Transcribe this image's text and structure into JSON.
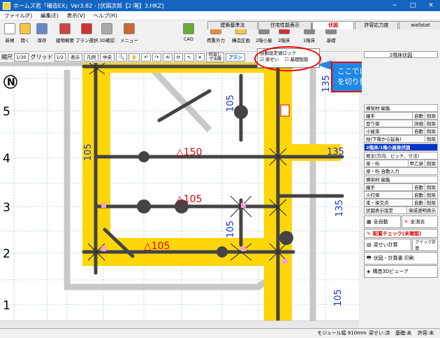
{
  "window": {
    "title": "ホームズ君「構造EX」Ver3.82 - [伏図次郎【2 階】3.HKZ]",
    "min": "−",
    "max": "□",
    "close": "✕"
  },
  "menu": [
    "ファイル(F)",
    "編集(E)",
    "表示(V)",
    "ヘルプ(H)"
  ],
  "toolbar": [
    {
      "label": "新規",
      "icon": "new-file-icon",
      "color": "#ffffff"
    },
    {
      "label": "開く",
      "icon": "open-folder-icon",
      "color": "#f4c542"
    },
    {
      "label": "保存",
      "icon": "save-icon",
      "color": "#6688cc"
    },
    {
      "label": "建物概要",
      "icon": "house-icon",
      "color": "#cc4444"
    },
    {
      "label": "プラン選択",
      "icon": "plan-icon",
      "color": "#cc3333"
    },
    {
      "label": "3D確認",
      "icon": "cube-icon",
      "color": "#aaaaaa"
    },
    {
      "label": "メニュー",
      "icon": "menu-icon",
      "color": "#cc6633"
    },
    {
      "label": "CAD",
      "icon": "cad-icon",
      "color": "#66aa33"
    },
    {
      "label": "荷重外力",
      "icon": "load-icon",
      "color": "#ee8833"
    },
    {
      "label": "構造区画",
      "icon": "zone-icon",
      "color": "#f4c542"
    },
    {
      "label": "2階小屋",
      "icon": "roof2-icon",
      "color": "#888888"
    },
    {
      "label": "2階床",
      "icon": "floor2-icon",
      "color": "#cc3333"
    },
    {
      "label": "1階床",
      "icon": "floor1-icon",
      "color": "#888888"
    },
    {
      "label": "基礎",
      "icon": "foundation-icon",
      "color": "#888888"
    }
  ],
  "tabs": [
    "建築基準法",
    "住宅性能表示",
    "伏図",
    "許容応力度",
    "wallstat"
  ],
  "active_tab": "伏図",
  "toolbar2": {
    "scale_label": "縮尺",
    "scale": "1/30",
    "grid_label": "グリッド",
    "grid": "1/2",
    "show": "表示",
    "legend": "凡例",
    "center": "中央",
    "dim": "吹出し",
    "dim2": "寸法線",
    "plan": "プラン"
  },
  "popup": {
    "title": "自動設定値ロック",
    "opt1": "梁せい",
    "opt2": "基礎配筋"
  },
  "callout": {
    "line1": "ここでロックON /OFF",
    "line2": "を切り替えます"
  },
  "canvas": {
    "rows": [
      "5",
      "4",
      "3",
      "2",
      "1"
    ],
    "compass": "N",
    "labels": [
      "△150",
      "△105",
      "△105"
    ],
    "beams": [
      "105",
      "105",
      "105",
      "135",
      "135",
      "135",
      "105"
    ]
  },
  "panel": {
    "title": "2階床伏図",
    "sec1": "横架材 編集",
    "rows1": [
      {
        "n": "継手",
        "a": "自動",
        "b": "削除"
      },
      {
        "n": "登り梁",
        "a": "詳細",
        "b": "削除"
      },
      {
        "n": "小屋束",
        "a": "自動",
        "b": "削除"
      },
      {
        "n": "柱(下階から延長)",
        "a": "",
        "b": "削除"
      }
    ],
    "sec2": "2階床/1階小屋梁伏図",
    "sec2b": "根太(方向、ピッチ、寸法)",
    "rows2": [
      {
        "n": "梁・桁",
        "a": "甲乙梁",
        "b": "削除"
      },
      {
        "n": "梁・桁 自動入力",
        "a": "",
        "b": ""
      }
    ],
    "sec3": "横架材 編集",
    "rows3": [
      {
        "n": "継手",
        "a": "自動",
        "b": "削除"
      },
      {
        "n": "火打梁",
        "a": "自動",
        "b": "削除"
      },
      {
        "n": "束・梁交点",
        "a": "自動",
        "b": "削除"
      }
    ],
    "row4": {
      "a": "伏図表示設定",
      "b": "梁成透明表示"
    },
    "btn_all": "全自動",
    "btn_clear": "全消去",
    "check": "配置チェック(未確認)",
    "btn_calc": "梁せい計算",
    "btn_quick": "クイック計算",
    "btn_print": "伏図・計算書 印刷",
    "btn_3d": "構造3Dビューア"
  },
  "status": {
    "module": "モジュール幅 910mm",
    "beam": "梁せい:済",
    "base": "基礎:未",
    "allow": "許容:未"
  }
}
